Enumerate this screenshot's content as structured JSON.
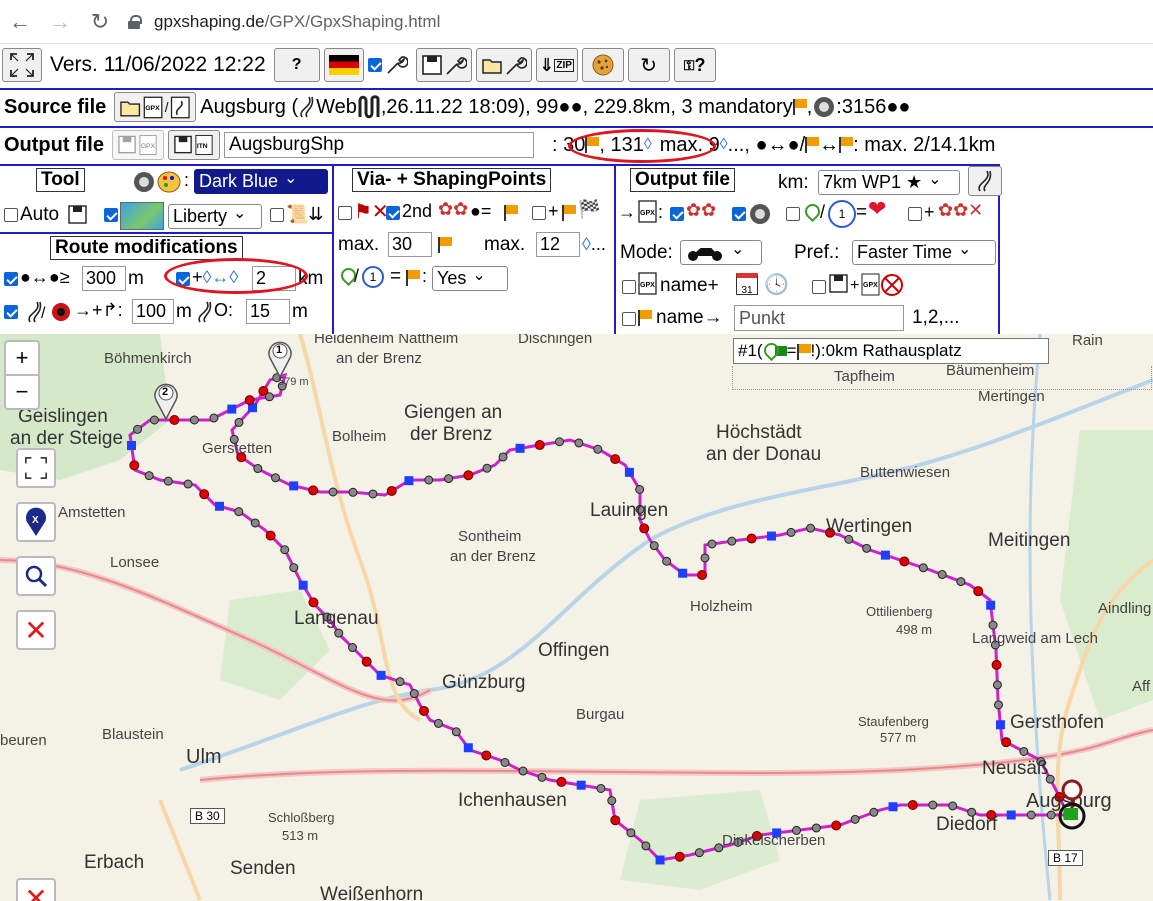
{
  "browser": {
    "url_host": "gpxshaping.de",
    "url_path": "/GPX/GpxShaping.html"
  },
  "toolbar": {
    "version": "Vers. 11/06/2022 12:22",
    "help_label": "?",
    "zip_label": "ZIP",
    "refresh_label": "↻",
    "keyq_label": "?"
  },
  "source_file": {
    "label": "Source file",
    "info_a": "Augsburg (",
    "info_b": "Web",
    "info_c": ",26.11.22 18:09), 99●●, 229.8km, 3 mandatory",
    "info_d": ", ",
    "info_e": ":3156●●"
  },
  "output_file": {
    "label": "Output file",
    "name_value": "AugsburgShp",
    "count_flags": ": 30",
    "count_shaping": ", 131",
    "max_a": "max. 9",
    "max_b": "..., ●↔●/",
    "max_c": "↔",
    "max_d": ": max. 2/14.1km"
  },
  "tool": {
    "title": "Tool",
    "color_select": "Dark Blue",
    "auto_label": "Auto",
    "map_select": "Liberty"
  },
  "via": {
    "title": "Via- + ShapingPoints",
    "second_label": "2nd",
    "eq": "●=",
    "plus": "+",
    "max_label_1": "max.",
    "max_value_1": "30",
    "max_label_2": "max.",
    "max_value_2": "12",
    "dots": "...",
    "eq2": "=",
    "yes_select": "Yes",
    "slash": "/"
  },
  "output_panel": {
    "title": "Output file",
    "km_label": "km:",
    "km_select": "7km WP1 ★",
    "arrow": "→",
    "mode_label": "Mode:",
    "pref_label": "Pref.:",
    "pref_select": "Faster Time",
    "name_plus": "name+",
    "name_arrow": "name→",
    "punkt_placeholder": "Punkt",
    "numbering": "1,2,...",
    "calendar_num": "31"
  },
  "route_mod": {
    "title": "Route modifications",
    "min_label": "●↔●≥",
    "min_value": "300",
    "min_unit": "m",
    "shaping_label": "+",
    "shaping_value": "2",
    "shaping_unit": "km",
    "arrow_plus": "→+↱:",
    "val_100": "100",
    "unit_m1": "m",
    "circle_o": "O:",
    "val_15": "15",
    "unit_m2": "m"
  },
  "map": {
    "info": "#1(",
    "info_b": "=",
    "info_c": "!):0km Rathausplatz",
    "labels": {
      "boehmenkirch": "Böhmenkirch",
      "heidenheim": "Heidenheim Nattheim",
      "an_der_brenz": "an der Brenz",
      "dischingen": "Dischingen",
      "rain": "Rain",
      "tapfheim": "Tapfheim",
      "baeumenheim": "Bäumenheim",
      "mertingen": "Mertingen",
      "geislingen": "Geislingen",
      "an_der_steige": "an der Steige",
      "giengen": "Giengen an",
      "der_brenz": "der Brenz",
      "bolheim": "Bolheim",
      "gerstetten": "Gerstetten",
      "hoechstaedt": "Höchstädt",
      "an_der_donau": "an der Donau",
      "buttenwiesen": "Buttenwiesen",
      "amstetten": "Amstetten",
      "lauingen": "Lauingen",
      "wertingen": "Wertingen",
      "meitingen": "Meitingen",
      "lonsee": "Lonsee",
      "sontheim": "Sontheim",
      "sontheim2": "an der Brenz",
      "holzheim": "Holzheim",
      "ottilienberg": "Ottilienberg",
      "ottilienberg_h": "498 m",
      "aindling": "Aindling",
      "langenau": "Langenau",
      "offingen": "Offingen",
      "langweid": "Langweid am Lech",
      "guenzburg": "Günzburg",
      "aff": "Aff",
      "burgau": "Burgau",
      "blaustein": "Blaustein",
      "staufenberg": "Staufenberg",
      "staufenberg_h": "577 m",
      "gersthofen": "Gersthofen",
      "beuren": "beuren",
      "ulm": "Ulm",
      "neusaess": "Neusäß",
      "ichenhausen": "Ichenhausen",
      "augsburg": "Augsburg",
      "schlossberg": "Schloßberg",
      "schlossberg_h": "513 m",
      "diedorf": "Diedorf",
      "dinkelscherben": "Dinkelscherben",
      "erbach": "Erbach",
      "senden": "Senden",
      "weissenhorn": "Weißenhorn",
      "b30": "B 30",
      "b17": "B 17",
      "ww": "579 m"
    },
    "zoom_in": "+",
    "zoom_out": "−",
    "markers": {
      "m1": "1",
      "m2": "2"
    }
  },
  "colors": {
    "route": "#cc22cc",
    "shaping": "#1f3fff",
    "via_red": "#e00000",
    "highlight_oval": "#e0141e",
    "panel_border": "#1e1ec8"
  }
}
